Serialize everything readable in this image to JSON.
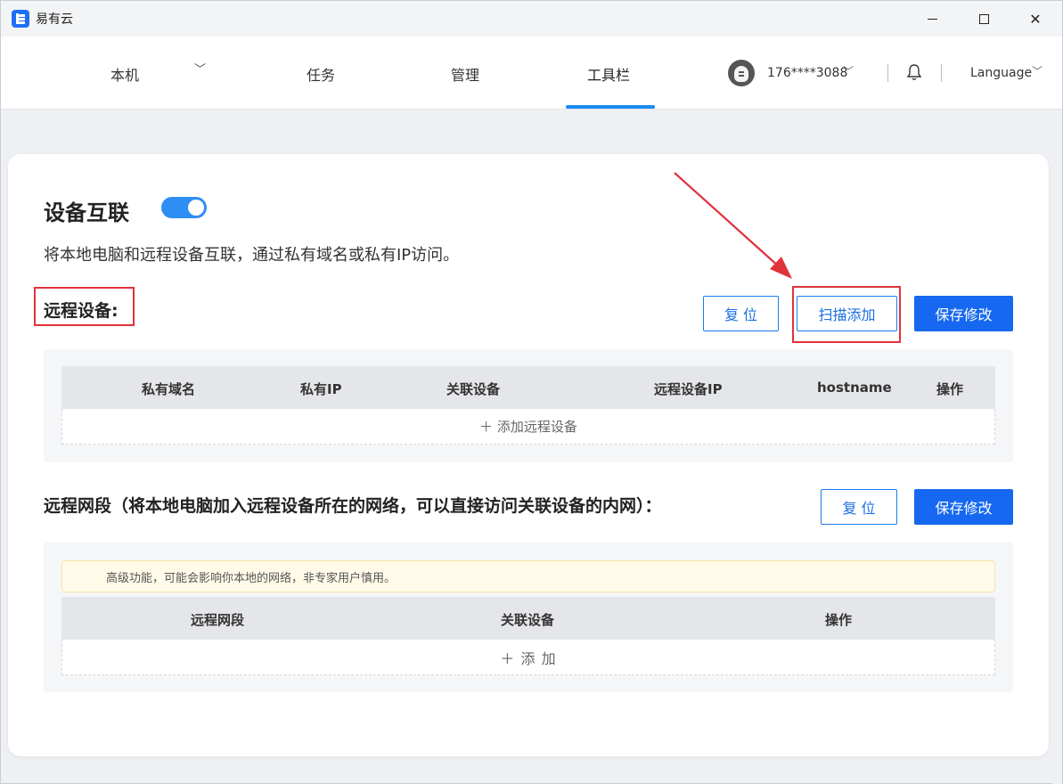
{
  "window": {
    "app_title": "易有云",
    "minimize_glyph": "—",
    "maximize_glyph": "☐",
    "close_glyph": "✕"
  },
  "nav": {
    "local": "本机",
    "local_chevron": "﹀",
    "tasks": "任务",
    "manage": "管理",
    "tools": "工具栏",
    "active_tab": "工具栏",
    "active_color": "#1a8cf0"
  },
  "user": {
    "phone": "176****3088",
    "chevron": "﹀",
    "language": "Language",
    "language_chevron": "﹀"
  },
  "interconnect": {
    "title": "设备互联",
    "enabled": true,
    "description": "将本地电脑和远程设备互联，通过私有域名或私有IP访问。"
  },
  "remote_devices": {
    "title": "远程设备:",
    "reset_label": "复 位",
    "scan_add_label": "扫描添加",
    "save_label": "保存修改",
    "columns": [
      "私有域名",
      "私有IP",
      "关联设备",
      "远程设备IP",
      "hostname",
      "操作"
    ],
    "add_row_label": "＋ 添加远程设备"
  },
  "remote_segments": {
    "title": "远程网段（将本地电脑加入远程设备所在的网络，可以直接访问关联设备的内网）：",
    "reset_label": "复 位",
    "save_label": "保存修改",
    "warning": "高级功能，可能会影响你本地的网络，非专家用户慎用。",
    "columns": [
      "远程网段",
      "关联设备",
      "操作"
    ],
    "add_row_label": "＋ 添 加"
  },
  "colors": {
    "primary": "#1668f0",
    "annotation_red": "#e0323b",
    "warning_bg": "#fffbe8"
  }
}
